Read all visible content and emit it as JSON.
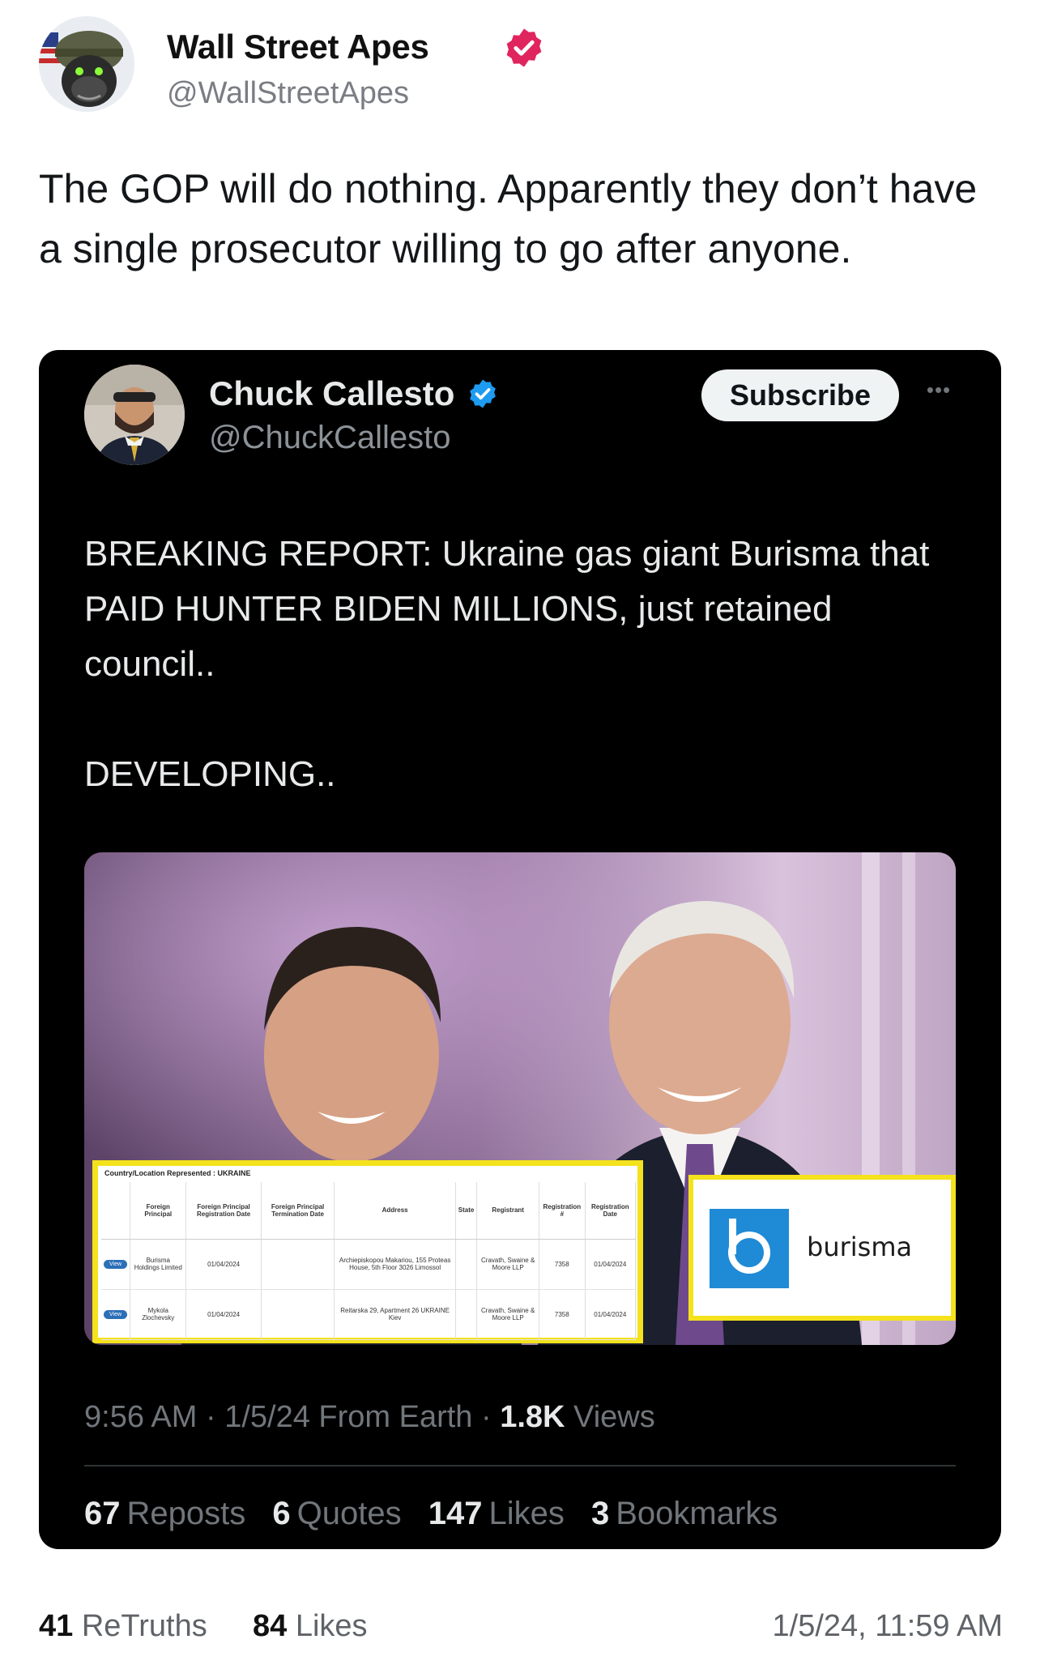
{
  "post": {
    "author_name": "Wall Street Apes",
    "author_handle": "@WallStreetApes",
    "text": "The GOP will do nothing. Apparently they don’t have a single prosecutor willing to go after anyone.",
    "verified_color": "#e0245e"
  },
  "embed": {
    "author_name": "Chuck Callesto",
    "author_handle": "@ChuckCallesto",
    "subscribe_label": "Subscribe",
    "more_label": "•••",
    "text": "BREAKING REPORT: Ukraine gas giant Burisma that PAID HUNTER BIDEN MILLIONS, just retained council..\n\nDEVELOPING..",
    "verified_color": "#1d9bf0",
    "meta": {
      "time_prefix": "9:56 AM · 1/5/24 From Earth · ",
      "views_count": "1.8K",
      "views_label": " Views"
    },
    "stats": [
      {
        "count": "67",
        "label": "Reposts"
      },
      {
        "count": "6",
        "label": "Quotes"
      },
      {
        "count": "147",
        "label": "Likes"
      },
      {
        "count": "3",
        "label": "Bookmarks"
      }
    ],
    "document": {
      "caption": "Country/Location Represented : UKRAINE",
      "headers": [
        "",
        "Foreign Principal",
        "Foreign Principal Registration Date",
        "Foreign Principal Termination Date",
        "Address",
        "State",
        "Registrant",
        "Registration #",
        "Registration Date"
      ],
      "rows": [
        [
          "View",
          "Burisma Holdings Limited",
          "01/04/2024",
          "",
          "Archiepiskopou Makariou, 155 Proteas House, 5th Floor 3026 Limossol",
          "",
          "Cravath, Swaine & Moore LLP",
          "7358",
          "01/04/2024"
        ],
        [
          "View",
          "Mykola Zlochevsky",
          "01/04/2024",
          "",
          "Reitarska 29, Apartment 26 UKRAINE Kiev",
          "",
          "Cravath, Swaine & Moore LLP",
          "7358",
          "01/04/2024"
        ]
      ]
    },
    "logo_text": "burisma"
  },
  "footer": {
    "retruths_count": "41",
    "retruths_label": "ReTruths",
    "likes_count": "84",
    "likes_label": "Likes",
    "timestamp": "1/5/24, 11:59 AM"
  }
}
